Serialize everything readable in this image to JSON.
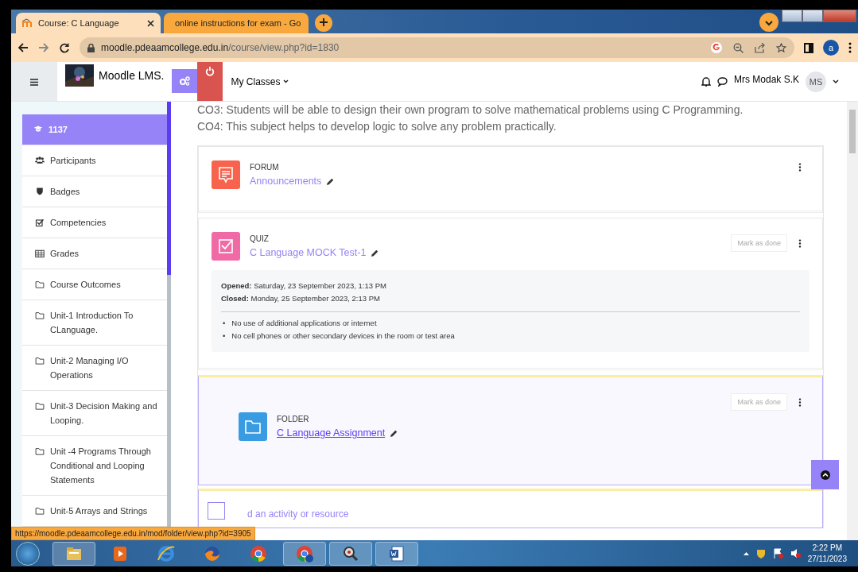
{
  "browser": {
    "tabs": [
      {
        "title": "Course: C Language",
        "kind": "moodle",
        "selected": true
      },
      {
        "title": "online instructions for exam - Go",
        "kind": "google",
        "selected": false
      }
    ],
    "url_host": "moodle.pdeaamcollege.edu.in",
    "url_path": "/course/view.php?id=1830",
    "profile_initial": "a"
  },
  "navbar": {
    "site_name": "Moodle LMS.",
    "menu": "My Classes",
    "user_name": "Mrs Modak S.K",
    "user_initials": "MS"
  },
  "sidebar": {
    "items": [
      {
        "label": "1137",
        "kind": "course",
        "selected": true
      },
      {
        "label": "Participants",
        "kind": "people",
        "selected": false
      },
      {
        "label": "Badges",
        "kind": "shield",
        "selected": false
      },
      {
        "label": "Competencies",
        "kind": "check",
        "selected": false
      },
      {
        "label": "Grades",
        "kind": "table",
        "selected": false
      },
      {
        "label": "Course Outcomes",
        "kind": "folder",
        "selected": false
      },
      {
        "label": "Unit-1 Introduction To CLanguage.",
        "kind": "folder",
        "selected": false
      },
      {
        "label": "Unit-2 Managing I/O Operations",
        "kind": "folder",
        "selected": false
      },
      {
        "label": "Unit-3 Decision Making and Looping.",
        "kind": "folder",
        "selected": false
      },
      {
        "label": "Unit -4 Programs Through Conditional and Looping Statements",
        "kind": "folder",
        "selected": false
      },
      {
        "label": "Unit-5 Arrays and Strings",
        "kind": "folder",
        "selected": false
      }
    ]
  },
  "content": {
    "outcomes": [
      "CO3: Students will be able to design their own program to solve mathematical problems using C Programming.",
      "CO4: This subject helps to develop logic to solve any problem practically."
    ],
    "activities": [
      {
        "kind": "forum",
        "type_label": "FORUM",
        "name": "Announcements",
        "hovered": false
      },
      {
        "kind": "quiz",
        "type_label": "QUIZ",
        "name": "C Language MOCK Test-1",
        "mark_done": "Mark as done",
        "hovered": false,
        "dates": [
          "**Opened:** Saturday, 23 September 2023, 1:13 PM",
          "**Closed:** Monday, 25 September 2023, 2:13 PM"
        ],
        "rules": [
          {
            "bullet": "•",
            "text": "No use of additional applications or internet"
          },
          {
            "bullet": "•",
            "text": "No cell phones or other secondary devices in the room or test area"
          }
        ]
      },
      {
        "kind": "folder",
        "type_label": "FOLDER",
        "name": "C Language Assignment",
        "mark_done": "Mark as done",
        "hovered": true
      }
    ],
    "add_activity": "d an activity or resource"
  },
  "status_url": "https://moodle.pdeaamcollege.edu.in/mod/folder/view.php?id=3905",
  "taskbar": {
    "apps": [
      {
        "kind": "explorer",
        "running": true
      },
      {
        "kind": "media",
        "running": false
      },
      {
        "kind": "ie",
        "running": false
      },
      {
        "kind": "firefox",
        "running": false
      },
      {
        "kind": "chrome",
        "running": false
      },
      {
        "kind": "chrome-profile",
        "running": true
      },
      {
        "kind": "magnifier",
        "running": true
      },
      {
        "kind": "word",
        "running": true
      }
    ],
    "time": "2:22 PM",
    "date": "27/11/2023"
  }
}
